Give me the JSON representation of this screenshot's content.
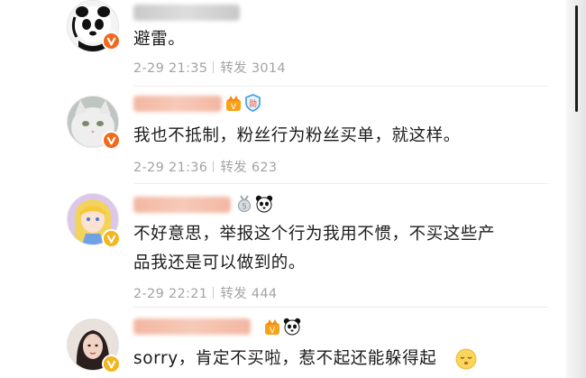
{
  "comments": [
    {
      "text": "避雷。",
      "time": "2-29 21:35",
      "repost_label": "转发",
      "repost_count": "3014",
      "verified_color": "#f16a1b"
    },
    {
      "text": "我也不抵制，粉丝行为粉丝买单，就这样。",
      "time": "2-29 21:36",
      "repost_label": "转发",
      "repost_count": "623",
      "verified_color": "#f16a1b"
    },
    {
      "text_line1": "不好意思，举报这个行为我用不惯，不买这些产",
      "text_line2": "品我还是可以做到的。",
      "time": "2-29 22:21",
      "repost_label": "转发",
      "repost_count": "444",
      "verified_color": "#f5b51b"
    },
    {
      "text": "sorry，肯定不买啦，惹不起还能躲得起",
      "verified_color": "#f5b51b"
    }
  ],
  "icons": {
    "badge_vip": "vip-crown-icon",
    "badge_shield": "shield-badge-icon",
    "badge_medal": "medal-icon",
    "badge_panda": "panda-icon",
    "emoji": "relieved-face-emoji"
  }
}
